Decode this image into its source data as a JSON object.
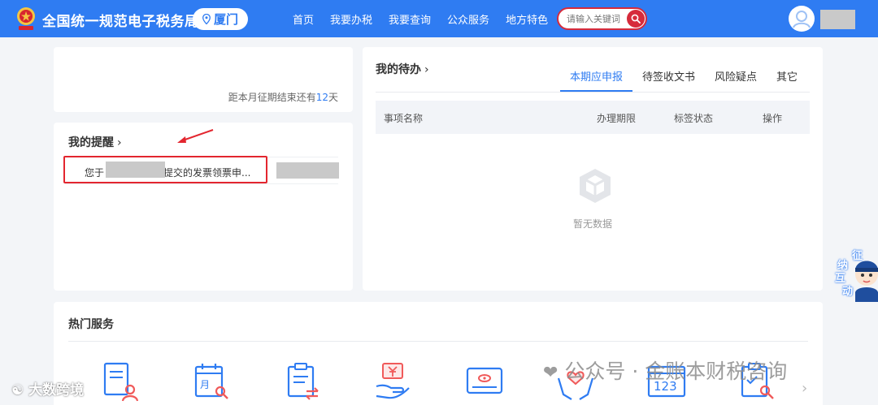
{
  "header": {
    "site_title": "全国统一规范电子税务局",
    "city": "厦门",
    "nav": [
      "首页",
      "我要办税",
      "我要查询",
      "公众服务",
      "地方特色"
    ],
    "search_placeholder": "请输入关键词",
    "brand_color": "#2f7cf2",
    "search_color": "#d62b3b"
  },
  "period": {
    "prefix": "距本月征期结束还有",
    "days": "12",
    "suffix": "天"
  },
  "reminder": {
    "title": "我的提醒",
    "chevron": "›",
    "item_prefix": "您于",
    "item_suffix": "提交的发票领票申..."
  },
  "todo": {
    "title": "我的待办",
    "chevron": "›",
    "tabs": [
      "本期应申报",
      "待签收文书",
      "风险疑点",
      "其它"
    ],
    "active_tab": "本期应申报",
    "columns": [
      "事项名称",
      "办理期限",
      "标签状态",
      "操作"
    ],
    "empty_text": "暂无数据"
  },
  "hot_services": {
    "title": "热门服务",
    "icons": [
      "invoice-user-icon",
      "calendar-month-search-icon",
      "clipboard-exchange-icon",
      "hand-yuan-icon",
      "id-card-icon",
      "hands-heart-icon",
      "calendar-123-icon",
      "clipboard-check-search-icon"
    ],
    "calendar_label": "月",
    "number_label": "123"
  },
  "float_widget": {
    "chars": [
      "征",
      "纳",
      "互",
      "动"
    ]
  },
  "watermarks": {
    "right": "公众号 · 金账本财税咨询",
    "left": "大数跨境"
  }
}
